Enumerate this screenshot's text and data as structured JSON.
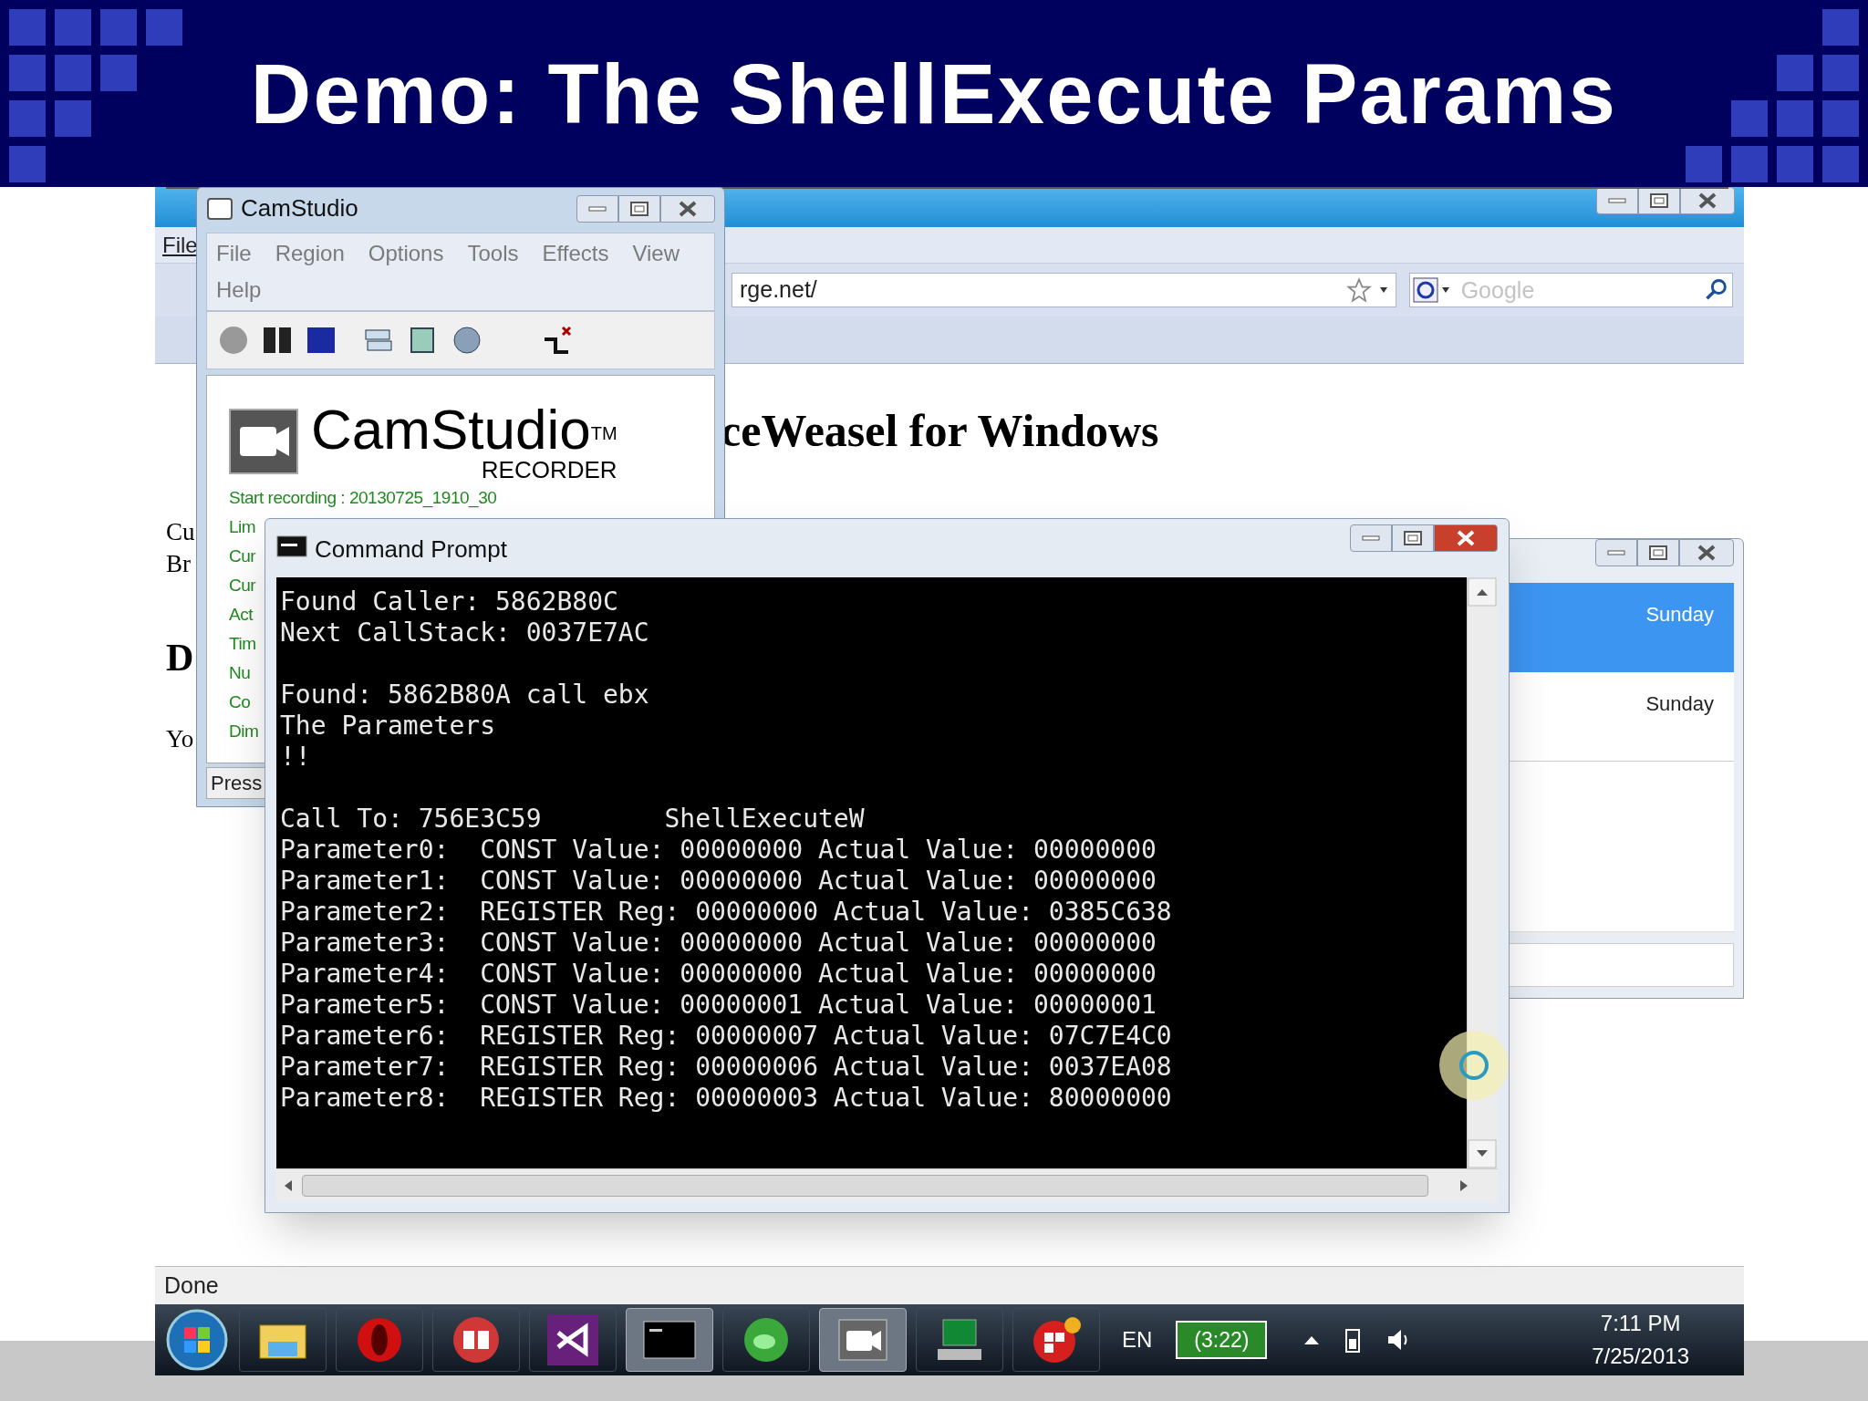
{
  "slide": {
    "title": "Demo: The ShellExecute Params"
  },
  "browser": {
    "menu": [
      "File"
    ],
    "address": "rge.net/",
    "search_placeholder": "Google",
    "heading": "ceWeasel for Windows",
    "fragments": [
      {
        "text": "Cu",
        "kind": "line"
      },
      {
        "text": "Br",
        "kind": "line"
      },
      {
        "text": "D",
        "kind": "heading"
      },
      {
        "text": "Yo",
        "kind": "line"
      }
    ],
    "status": "Done"
  },
  "camstudio": {
    "title": "CamStudio",
    "menu": [
      "File",
      "Region",
      "Options",
      "Tools",
      "Effects",
      "View",
      "Help"
    ],
    "logo": "CamStudio$^{TM}$",
    "subtitle": "RECORDER",
    "status_lines": [
      "Start recording : 20130725_1910_30",
      "Lim",
      "Cur",
      "Cur",
      "Act",
      "Tim",
      "Nu",
      "Co",
      "Dim"
    ],
    "statusbar": "Press"
  },
  "cmd": {
    "title": "Command Prompt",
    "blocks": [
      [
        "Found Caller: 5862B80C",
        "Next CallStack: 0037E7AC"
      ],
      [
        "Found: 5862B80A call ebx",
        "The Parameters",
        "!!"
      ],
      [
        "Call To: 756E3C59        ShellExecuteW",
        "Parameter0:  CONST Value: 00000000 Actual Value: 00000000",
        "Parameter1:  CONST Value: 00000000 Actual Value: 00000000",
        "Parameter2:  REGISTER Reg: 00000000 Actual Value: 0385C638",
        "Parameter3:  CONST Value: 00000000 Actual Value: 00000000",
        "Parameter4:  CONST Value: 00000000 Actual Value: 00000000",
        "Parameter5:  CONST Value: 00000001 Actual Value: 00000001",
        "Parameter6:  REGISTER Reg: 00000007 Actual Value: 07C7E4C0",
        "Parameter7:  REGISTER Reg: 00000006 Actual Value: 0037EA08",
        "Parameter8:  REGISTER Reg: 00000003 Actual Value: 80000000"
      ]
    ]
  },
  "calendar_window": {
    "rows": [
      {
        "label": "Sunday",
        "selected": true
      },
      {
        "label": "Sunday",
        "selected": false
      }
    ]
  },
  "taskbar": {
    "language": "EN",
    "battery": "(3:22)",
    "time": "7:11 PM",
    "date": "7/25/2013"
  }
}
